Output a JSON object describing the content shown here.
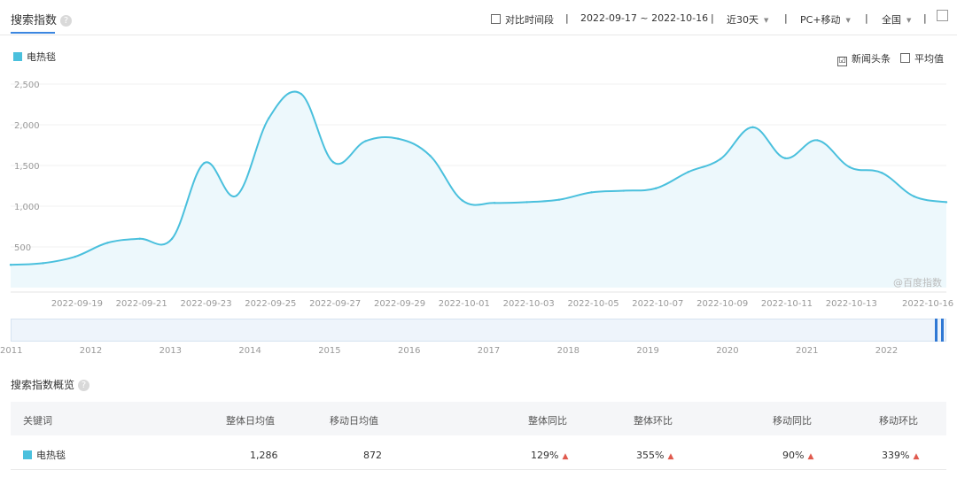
{
  "header": {
    "tab_title": "搜索指数",
    "compare_label": "对比时间段",
    "date_range": "2022-09-17 ~ 2022-10-16",
    "period": "近30天",
    "device": "PC+移动",
    "region": "全国"
  },
  "legend": {
    "series_name": "电热毯",
    "news_label": "新闻头条",
    "avg_label": "平均值",
    "news_checked": "☑"
  },
  "watermark": "@百度指数",
  "colors": {
    "line": "#4ac0dd",
    "fill": "#edf8fc",
    "accent": "#3b86e0",
    "up_arrow": "#e05a4e"
  },
  "chart_data": {
    "type": "area",
    "ylim": [
      0,
      2500
    ],
    "y_ticks": [
      "500",
      "1,000",
      "1,500",
      "2,000",
      "2,500"
    ],
    "x_ticks": [
      "2022-09-19",
      "2022-09-21",
      "2022-09-23",
      "2022-09-25",
      "2022-09-27",
      "2022-09-29",
      "2022-10-01",
      "2022-10-03",
      "2022-10-05",
      "2022-10-07",
      "2022-10-09",
      "2022-10-11",
      "2022-10-13",
      "2022-10-16"
    ],
    "x": [
      "2022-09-17",
      "2022-09-18",
      "2022-09-19",
      "2022-09-20",
      "2022-09-21",
      "2022-09-22",
      "2022-09-23",
      "2022-09-24",
      "2022-09-25",
      "2022-09-26",
      "2022-09-27",
      "2022-09-28",
      "2022-09-29",
      "2022-09-30",
      "2022-10-01",
      "2022-10-02",
      "2022-10-03",
      "2022-10-04",
      "2022-10-05",
      "2022-10-06",
      "2022-10-07",
      "2022-10-08",
      "2022-10-09",
      "2022-10-10",
      "2022-10-11",
      "2022-10-12",
      "2022-10-13",
      "2022-10-14",
      "2022-10-15",
      "2022-10-16"
    ],
    "series": [
      {
        "name": "电热毯",
        "values": [
          280,
          300,
          380,
          550,
          600,
          600,
          1530,
          1130,
          2080,
          2380,
          1540,
          1800,
          1830,
          1620,
          1070,
          1040,
          1050,
          1080,
          1170,
          1190,
          1220,
          1420,
          1580,
          1970,
          1590,
          1810,
          1480,
          1410,
          1120,
          1050
        ]
      }
    ],
    "timeline_years": [
      "2011",
      "2012",
      "2013",
      "2014",
      "2015",
      "2016",
      "2017",
      "2018",
      "2019",
      "2020",
      "2021",
      "2022"
    ]
  },
  "summary": {
    "title": "搜索指数概览",
    "headers": [
      "关键词",
      "整体日均值",
      "移动日均值",
      "整体同比",
      "整体环比",
      "移动同比",
      "移动环比"
    ],
    "row": {
      "keyword": "电热毯",
      "overall_avg": "1,286",
      "mobile_avg": "872",
      "overall_yoy": "129%",
      "overall_mom": "355%",
      "mobile_yoy": "90%",
      "mobile_mom": "339%",
      "arrow": "▲"
    }
  }
}
